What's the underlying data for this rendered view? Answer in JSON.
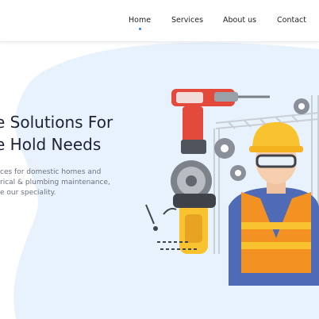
{
  "nav": {
    "items": [
      {
        "label": "Home",
        "active": true
      },
      {
        "label": "Services"
      },
      {
        "label": "About us"
      },
      {
        "label": "Contact"
      }
    ],
    "accent_color": "#2f80ed"
  },
  "hero": {
    "headline_line1": "e Solutions For",
    "headline_line2": "e Hold Needs",
    "sub_line1": "ces for domestic homes and",
    "sub_line2": "rical & plumbing maintenance,",
    "sub_line3": "e our speciality."
  },
  "colors": {
    "blob": "#e8f2fd",
    "vest": "#f39222",
    "helmet": "#f9c32f",
    "drill": "#e34a3c"
  }
}
